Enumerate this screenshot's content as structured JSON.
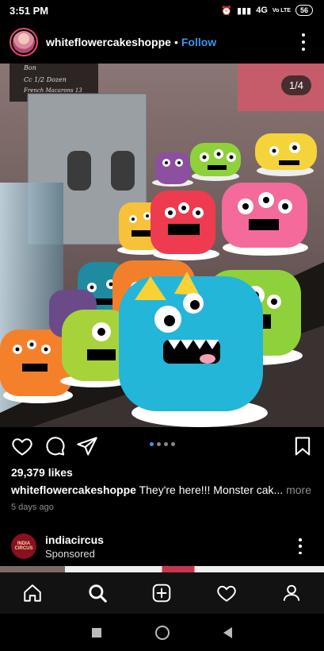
{
  "status": {
    "time": "3:51 PM",
    "network": "4G",
    "volte": "Vo LTE",
    "battery": "56"
  },
  "post": {
    "username": "whiteflowercakeshoppe",
    "separator": "•",
    "follow_label": "Follow",
    "image_counter": "1/4",
    "likes": "29,379 likes",
    "caption_user": "whiteflowercakeshoppe",
    "caption_text": "They're here!!! Monster cak...",
    "caption_more": "more",
    "timestamp": "5 days ago",
    "carousel_total": 4,
    "carousel_active": 0
  },
  "photo_sign": {
    "line1": "Bon",
    "line2": "Cc 1/2 Dozen",
    "line3": "French Macarons 13"
  },
  "sponsored": {
    "name": "indiacircus",
    "label": "Sponsored",
    "avatar_text": "INDIA CIRCUS"
  },
  "icons": {
    "like": "heart-icon",
    "comment": "comment-icon",
    "share": "send-icon",
    "save": "bookmark-icon",
    "home": "home-icon",
    "search": "search-icon",
    "new_post": "add-post-icon",
    "activity": "heart-icon",
    "profile": "profile-icon"
  },
  "colors": {
    "link": "#3897f0",
    "tabbar": "#121212",
    "muted": "#8e8e8e"
  }
}
